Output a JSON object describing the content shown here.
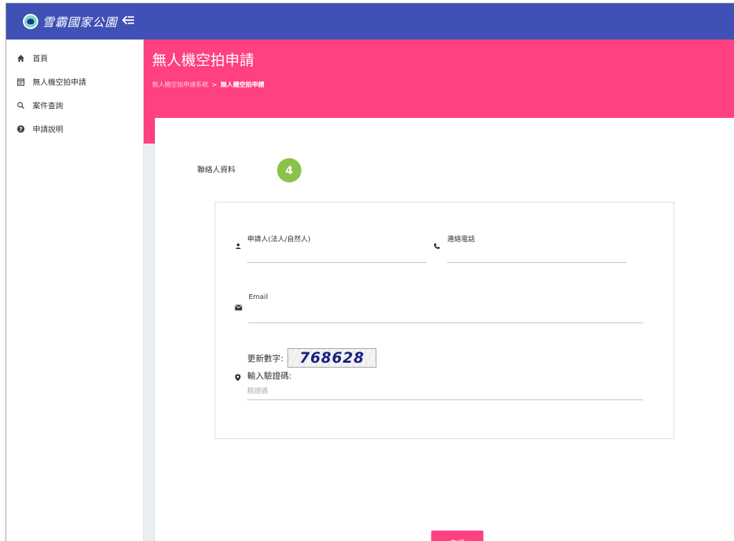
{
  "header": {
    "logo_text": "雪霸國家公園",
    "menu_toggle_icon": "menu-collapse-icon",
    "bar_color": "#3f51b5"
  },
  "sidebar": {
    "items": [
      {
        "label": "首頁",
        "icon": "home-icon"
      },
      {
        "label": "無人機空拍申請",
        "icon": "calendar-icon"
      },
      {
        "label": "案件查詢",
        "icon": "search-icon"
      },
      {
        "label": "申請說明",
        "icon": "help-icon"
      }
    ]
  },
  "page": {
    "title": "無人機空拍申請",
    "breadcrumb": {
      "parent": "無人機空拍申請系統",
      "separator": ">",
      "current": "無人機空拍申請"
    },
    "accent_color": "#ff4081"
  },
  "form": {
    "section_title": "聯絡人資料",
    "step_number": "4",
    "step_color": "#8bc34a",
    "fields": {
      "applicant": {
        "label": "申請人(法人/自然人)",
        "icon": "person-icon",
        "value": ""
      },
      "phone": {
        "label": "連絡電話",
        "icon": "phone-icon",
        "value": ""
      },
      "email": {
        "label": "Email",
        "icon": "email-icon",
        "value": ""
      },
      "captcha": {
        "refresh_label": "更新數字:",
        "code": "768628",
        "input_label": "輸入驗證碼:",
        "placeholder": "驗證碼",
        "icon": "location-pin-icon"
      }
    },
    "submit_label": "申請"
  }
}
